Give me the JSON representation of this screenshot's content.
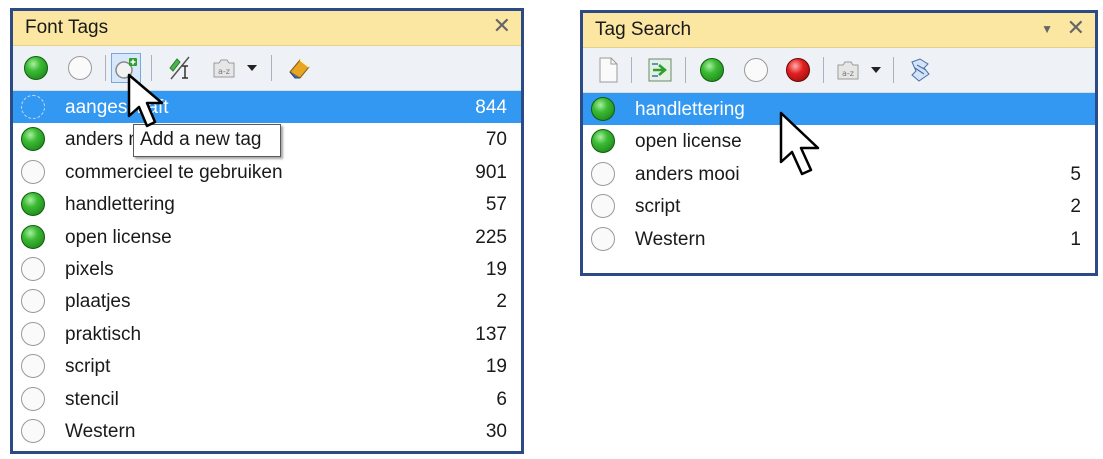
{
  "font_tags_panel": {
    "title": "Font Tags",
    "close_label": "✕",
    "tooltip": "Add a new tag",
    "rows": [
      {
        "label": "aangeschaft",
        "count": "844",
        "status": "dotted",
        "selected": true
      },
      {
        "label": "anders mooi",
        "count": "70",
        "status": "green"
      },
      {
        "label": "commercieel te gebruiken",
        "count": "901",
        "status": "empty"
      },
      {
        "label": "handlettering",
        "count": "57",
        "status": "green"
      },
      {
        "label": "open license",
        "count": "225",
        "status": "green"
      },
      {
        "label": "pixels",
        "count": "19",
        "status": "empty"
      },
      {
        "label": "plaatjes",
        "count": "2",
        "status": "empty"
      },
      {
        "label": "praktisch",
        "count": "137",
        "status": "empty"
      },
      {
        "label": "script",
        "count": "19",
        "status": "empty"
      },
      {
        "label": "stencil",
        "count": "6",
        "status": "empty"
      },
      {
        "label": "Western",
        "count": "30",
        "status": "empty"
      }
    ]
  },
  "tag_search_panel": {
    "title": "Tag Search",
    "pin_label": "▼",
    "close_label": "✕",
    "rows": [
      {
        "label": "handlettering",
        "count": "",
        "status": "green",
        "selected": true
      },
      {
        "label": "open license",
        "count": "",
        "status": "green"
      },
      {
        "label": "anders mooi",
        "count": "5",
        "status": "empty"
      },
      {
        "label": "script",
        "count": "2",
        "status": "empty"
      },
      {
        "label": "Western",
        "count": "1",
        "status": "empty"
      }
    ]
  },
  "colors": {
    "title_bar": "#fbe6a2",
    "border": "#2c4a86",
    "selection": "#3298f1",
    "toolbar": "#eef1f5"
  },
  "icons": {
    "left_toolbar": [
      "green-tag-icon",
      "empty-tag-icon",
      "add-tag-icon",
      "rename-tag-icon",
      "tag-options-icon",
      "dropdown-arrow-icon",
      "clear-tags-icon"
    ],
    "right_toolbar": [
      "new-search-icon",
      "apply-search-icon",
      "green-tag-icon",
      "empty-tag-icon",
      "red-tag-icon",
      "search-options-icon",
      "dropdown-arrow-icon",
      "search-help-icon"
    ]
  }
}
